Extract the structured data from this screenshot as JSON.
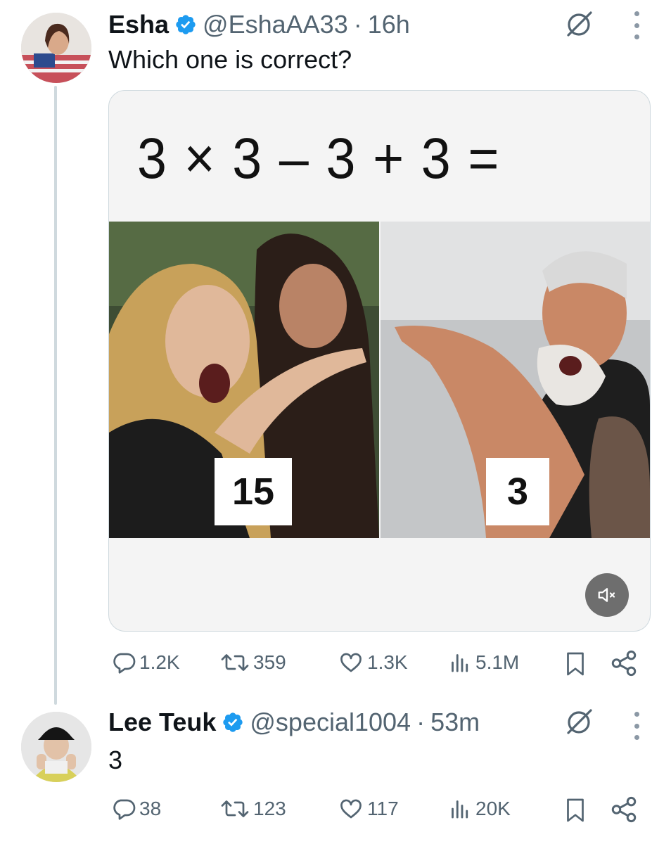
{
  "colors": {
    "text": "#0f1419",
    "muted": "#536471",
    "verified": "#1d9bf0",
    "border": "#cfd9de"
  },
  "tweet1": {
    "author": "Esha",
    "handle": "@EshaAA33",
    "dot": "·",
    "time": "16h",
    "text": "Which one is correct?",
    "media": {
      "equation": "3 × 3 – 3 + 3 =",
      "left_answer": "15",
      "right_answer": "3"
    },
    "stats": {
      "replies": "1.2K",
      "reposts": "359",
      "likes": "1.3K",
      "views": "5.1M"
    }
  },
  "tweet2": {
    "author": "Lee Teuk",
    "handle": "@special1004",
    "dot": "·",
    "time": "53m",
    "text": "3",
    "stats": {
      "replies": "38",
      "reposts": "123",
      "likes": "117",
      "views": "20K"
    }
  },
  "icons": [
    "verified-badge-icon",
    "grok-icon",
    "more-icon",
    "reply-icon",
    "repost-icon",
    "like-icon",
    "views-icon",
    "bookmark-icon",
    "share-icon",
    "mute-icon"
  ]
}
